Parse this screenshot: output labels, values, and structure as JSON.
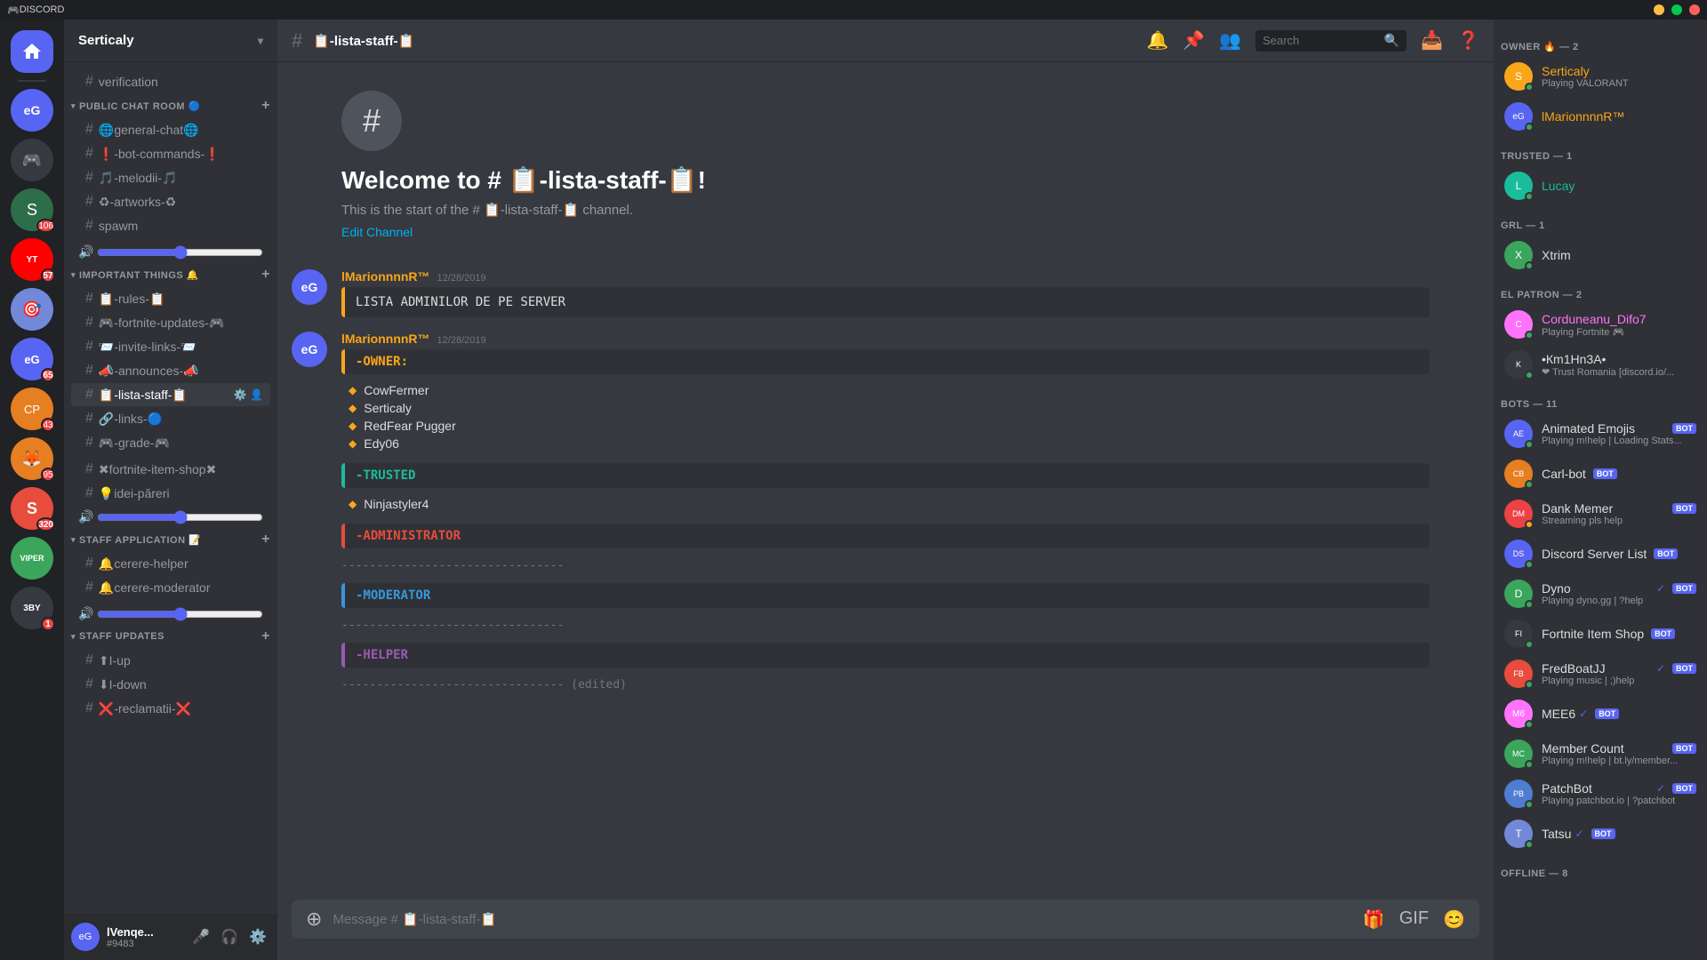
{
  "app": {
    "title": "DISCORD",
    "server_name": "Serticaly"
  },
  "titlebar": {
    "title": "DISCORD"
  },
  "server_list": [
    {
      "id": "home",
      "label": "🏠",
      "color": "#5865f2"
    },
    {
      "id": "s1",
      "label": "eG",
      "color": "#5865f2",
      "badge": ""
    },
    {
      "id": "s2",
      "label": "🎮",
      "color": "#36393f"
    },
    {
      "id": "s3",
      "label": "S",
      "color": "#2c6e49",
      "badge": "106"
    },
    {
      "id": "s4",
      "label": "YT",
      "color": "#ff0000",
      "badge": "57"
    },
    {
      "id": "s5",
      "label": "🎯",
      "color": "#36393f"
    },
    {
      "id": "s6",
      "label": "eG",
      "color": "#5865f2",
      "badge": "65"
    },
    {
      "id": "s7",
      "label": "CP",
      "color": "#e67e22",
      "badge": "43"
    },
    {
      "id": "s8",
      "label": "🦊",
      "color": "#e67e22",
      "badge": "95"
    },
    {
      "id": "s9",
      "label": "S",
      "color": "#e74c3c",
      "badge": "320"
    },
    {
      "id": "s10",
      "label": "VIPER",
      "color": "#3ba55c",
      "badge": ""
    },
    {
      "id": "s11",
      "label": "3BY",
      "color": "#36393f",
      "badge": "1"
    }
  ],
  "sidebar": {
    "server_name": "Serticaly",
    "channels": [
      {
        "type": "standalone",
        "name": "verification",
        "id": "verification",
        "badge": ""
      },
      {
        "type": "category",
        "name": "PUBLIC CHAT ROOM",
        "collapsed": false,
        "items": [
          {
            "name": "🌐general-chat🌐",
            "id": "general-chat",
            "badge": ""
          },
          {
            "name": "❗-bot-commands-❗",
            "id": "bot-commands",
            "badge": ""
          },
          {
            "name": "🎵-melodii-🎵",
            "id": "melodii",
            "badge": ""
          },
          {
            "name": "♻-artworks-♻",
            "id": "artworks",
            "badge": ""
          },
          {
            "name": "spawm",
            "id": "spawm",
            "badge": ""
          }
        ]
      },
      {
        "type": "category",
        "name": "IMPORTANT THINGS 🔔",
        "collapsed": false,
        "items": [
          {
            "name": "📋-rules-📋",
            "id": "rules",
            "badge": ""
          },
          {
            "name": "🎮-fortnite-updates-🎮",
            "id": "fortnite-updates",
            "badge": ""
          },
          {
            "name": "📨-invite-links-📨",
            "id": "invite-links",
            "badge": ""
          },
          {
            "name": "📣-announces-📣",
            "id": "announces",
            "badge": ""
          },
          {
            "name": "📋-lista-staff-📋",
            "id": "lista-staff",
            "active": true,
            "badge": "",
            "icons": [
              "⚙️",
              "👤"
            ]
          },
          {
            "name": "🔗-links-🔵",
            "id": "links",
            "badge": ""
          },
          {
            "name": "🎮-grade-🎮",
            "id": "grade",
            "badge": ""
          }
        ]
      },
      {
        "type": "standalone",
        "name": "✖fortnite-item-shop✖",
        "id": "fortnite-item-shop",
        "badge": ""
      },
      {
        "type": "standalone",
        "name": "💡idei-păreri",
        "id": "idei-pareri",
        "badge": ""
      },
      {
        "type": "category",
        "name": "STAFF APPLICATION 📝",
        "collapsed": false,
        "items": [
          {
            "name": "🔔cerere-helper",
            "id": "cerere-helper",
            "badge": ""
          },
          {
            "name": "🔔cerere-moderator",
            "id": "cerere-moderator",
            "badge": ""
          }
        ]
      },
      {
        "type": "category",
        "name": "STAFF UPDATES",
        "collapsed": false,
        "items": [
          {
            "name": "⬆I-up",
            "id": "i-up",
            "badge": ""
          },
          {
            "name": "⬇I-down",
            "id": "i-down",
            "badge": ""
          },
          {
            "name": "❌-reclamatii-❌",
            "id": "reclamatii",
            "badge": ""
          }
        ]
      }
    ],
    "current_user": {
      "name": "lVenqe...",
      "tag": "#9483",
      "avatar": "eG",
      "color": "#5865f2"
    }
  },
  "header": {
    "channel_name": "📋-lista-staff-📋",
    "search_placeholder": "Search"
  },
  "channel_content": {
    "icon": "#",
    "welcome_title": "Welcome to # 📋-lista-staff-📋!",
    "welcome_desc": "This is the start of the # 📋-lista-staff-📋 channel.",
    "edit_channel_label": "Edit Channel",
    "messages": [
      {
        "id": "msg1",
        "author": "lMarionnnnR™",
        "author_color": "#faa61a",
        "timestamp": "12/28/2019",
        "avatar_text": "eG",
        "avatar_color": "#5865f2",
        "box_text": "LISTA ADMINILOR DE PE SERVER"
      },
      {
        "id": "msg2",
        "author": "lMarionnnnR™",
        "author_color": "#faa61a",
        "timestamp": "12/28/2019",
        "avatar_text": "eG",
        "avatar_color": "#5865f2",
        "sections": [
          {
            "type": "owner",
            "label": "-OWNER:",
            "members": [
              "CowFermer",
              "Serticaly",
              "RedFear Pugger",
              "Edy06"
            ]
          },
          {
            "type": "trusted",
            "label": "-TRUSTED",
            "members": [
              "Ninjastyler4"
            ]
          },
          {
            "type": "admin",
            "label": "-ADMINISTRATOR",
            "members": []
          },
          {
            "type": "separator1",
            "text": "--------------------------------"
          },
          {
            "type": "moderator",
            "label": "-MODERATOR",
            "members": []
          },
          {
            "type": "separator2",
            "text": "--------------------------------"
          },
          {
            "type": "helper",
            "label": "-HELPER",
            "members": []
          },
          {
            "type": "separator3",
            "text": "-------------------------------- (edited)"
          }
        ]
      }
    ]
  },
  "message_input": {
    "placeholder": "Message # 📋-lista-staff-📋"
  },
  "right_sidebar": {
    "categories": [
      {
        "name": "OWNER 🔥 — 2",
        "members": [
          {
            "name": "Serticaly",
            "status": "online",
            "sub": "Playing VALORANT",
            "color": "owner-color",
            "avatar": "S",
            "avatar_color": "#faa61a"
          },
          {
            "name": "lMarionnnnR™",
            "status": "online",
            "sub": "",
            "color": "owner-color",
            "avatar": "eG",
            "avatar_color": "#5865f2"
          }
        ]
      },
      {
        "name": "TRUSTED — 1",
        "members": [
          {
            "name": "Lucay",
            "status": "online",
            "sub": "",
            "color": "trusted-color",
            "avatar": "L",
            "avatar_color": "#1abc9c"
          }
        ]
      },
      {
        "name": "GRL — 1",
        "members": [
          {
            "name": "Xtrim",
            "status": "online",
            "sub": "",
            "color": "",
            "avatar": "X",
            "avatar_color": "#3ba55c"
          }
        ]
      },
      {
        "name": "EL PATRON — 2",
        "members": [
          {
            "name": "Corduneanu_Difo7",
            "status": "online",
            "sub": "Playing Fortnite 🎮",
            "color": "patron-color",
            "avatar": "C",
            "avatar_color": "#ff73fa"
          },
          {
            "name": "•Кm1Нn3А•",
            "status": "online",
            "sub": "❤ Trust Romania [discord.io/...",
            "color": "",
            "avatar": "K",
            "avatar_color": "#36393f"
          }
        ]
      },
      {
        "name": "BOTS — 11",
        "members": [
          {
            "name": "Animated Emojis",
            "status": "online",
            "sub": "Playing m!help | Loading Stats...",
            "color": "",
            "bot": true,
            "avatar": "AE",
            "avatar_color": "#5865f2"
          },
          {
            "name": "Carl-bot",
            "status": "online",
            "sub": "",
            "color": "",
            "bot": true,
            "avatar": "CB",
            "avatar_color": "#e67e22"
          },
          {
            "name": "Dank Memer",
            "status": "online",
            "sub": "Streaming pls help",
            "color": "",
            "bot": true,
            "avatar": "DM",
            "avatar_color": "#ed4245"
          },
          {
            "name": "Discord Server List",
            "status": "online",
            "sub": "",
            "color": "",
            "bot": true,
            "avatar": "DS",
            "avatar_color": "#5865f2"
          },
          {
            "name": "Dyno",
            "status": "online",
            "sub": "Playing dyno.gg | ?help",
            "color": "",
            "bot": true,
            "verified": true,
            "avatar": "D",
            "avatar_color": "#3ba55c"
          },
          {
            "name": "Fortnite Item Shop",
            "status": "online",
            "sub": "",
            "color": "",
            "bot": true,
            "avatar": "FI",
            "avatar_color": "#36393f"
          },
          {
            "name": "FredBoatJJ",
            "status": "online",
            "sub": "Playing music | ;)help",
            "color": "",
            "bot": true,
            "verified": true,
            "avatar": "FB",
            "avatar_color": "#e74c3c"
          },
          {
            "name": "MEE6",
            "status": "online",
            "sub": "",
            "color": "",
            "bot": true,
            "verified": true,
            "avatar": "M6",
            "avatar_color": "#ff73fa"
          },
          {
            "name": "Member Count",
            "status": "online",
            "sub": "Playing m!help | bt.ly/member...",
            "color": "",
            "bot": true,
            "avatar": "MC",
            "avatar_color": "#3ba55c"
          },
          {
            "name": "PatchBot",
            "status": "online",
            "sub": "Playing patchbot.io | ?patchbot",
            "color": "",
            "bot": true,
            "verified": true,
            "avatar": "PB",
            "avatar_color": "#4e7dd1"
          },
          {
            "name": "Tatsu",
            "status": "online",
            "sub": "",
            "color": "",
            "bot": true,
            "verified": true,
            "avatar": "T",
            "avatar_color": "#7289da"
          }
        ]
      },
      {
        "name": "OFFLINE — 8",
        "members": []
      }
    ]
  }
}
